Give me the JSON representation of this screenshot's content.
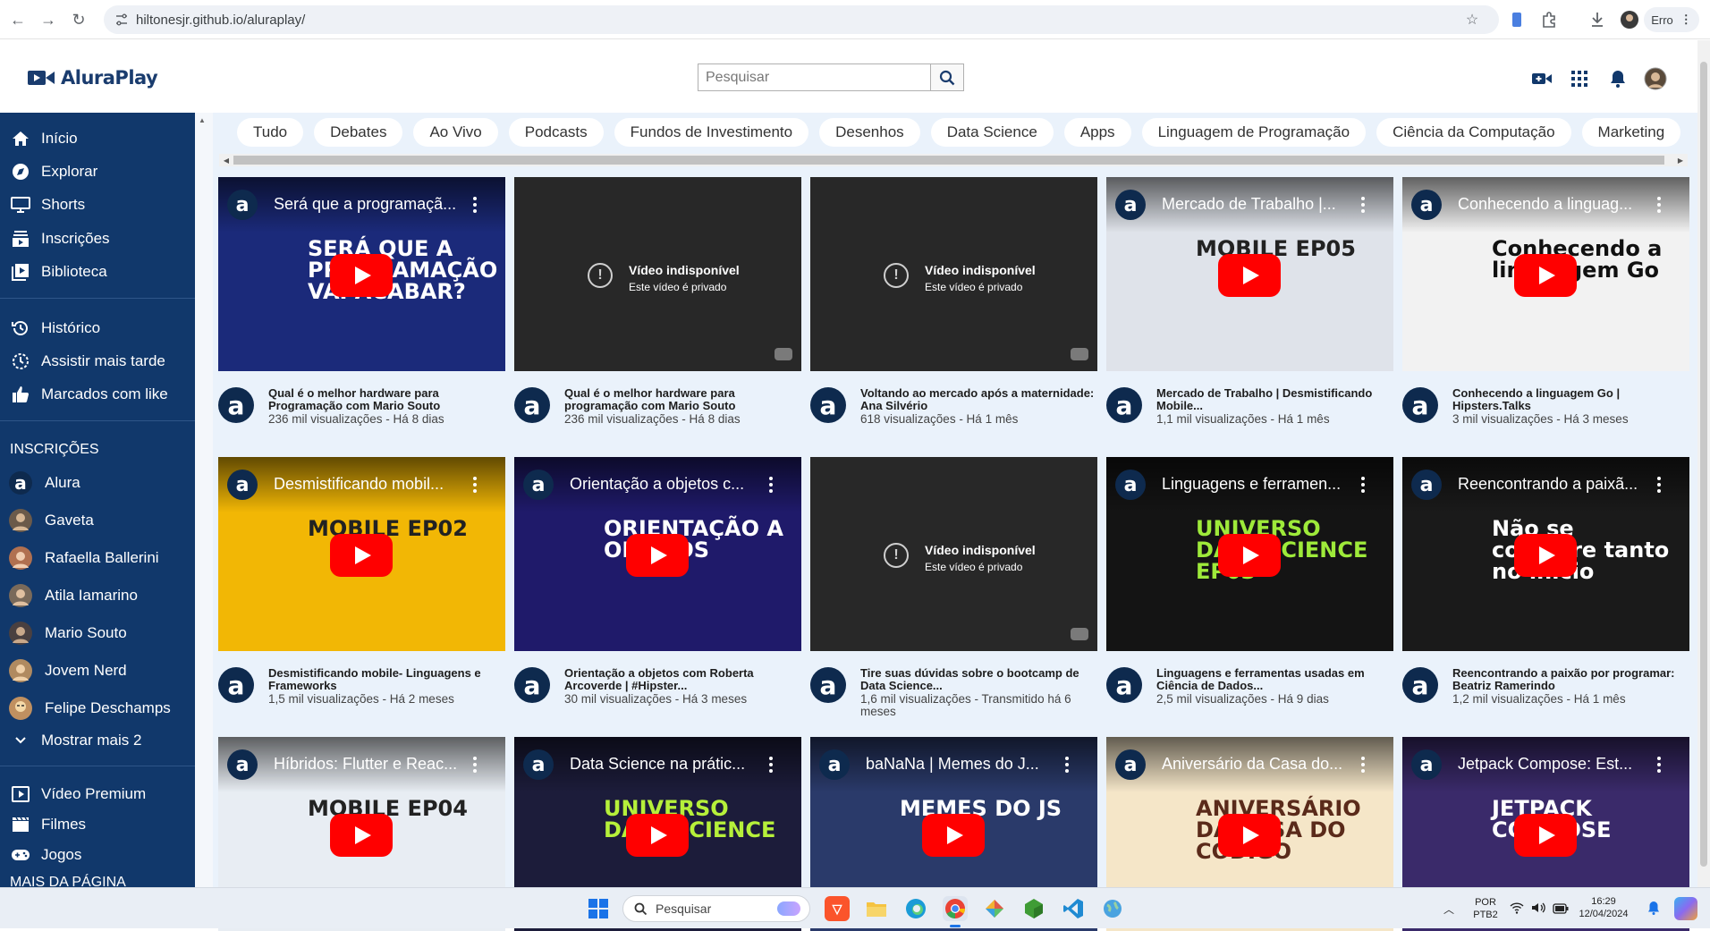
{
  "browser": {
    "url": "hiltonesjr.github.io/aluraplay/",
    "profile_label": "Erro"
  },
  "app": {
    "logo_text": "AluraPlay",
    "search_placeholder": "Pesquisar"
  },
  "sidebar": {
    "main": [
      {
        "label": "Início",
        "icon": "home-icon"
      },
      {
        "label": "Explorar",
        "icon": "compass-icon"
      },
      {
        "label": "Shorts",
        "icon": "screen-icon"
      },
      {
        "label": "Inscrições",
        "icon": "subscriptions-icon"
      },
      {
        "label": "Biblioteca",
        "icon": "library-icon"
      }
    ],
    "library": [
      {
        "label": "Histórico",
        "icon": "history-icon"
      },
      {
        "label": "Assistir mais tarde",
        "icon": "clock-icon"
      },
      {
        "label": "Marcados com like",
        "icon": "thumbs-up-icon"
      }
    ],
    "subscriptions_heading": "INSCRIÇÕES",
    "subscriptions": [
      {
        "label": "Alura",
        "color": "#0e2a4e"
      },
      {
        "label": "Gaveta",
        "color": "#6b5a4a"
      },
      {
        "label": "Rafaella Ballerini",
        "color": "#b07050"
      },
      {
        "label": "Atila Iamarino",
        "color": "#7a6a5a"
      },
      {
        "label": "Mario Souto",
        "color": "#4a4040"
      },
      {
        "label": "Jovem Nerd",
        "color": "#b08a60"
      },
      {
        "label": "Felipe Deschamps",
        "color": "#c09060"
      }
    ],
    "show_more": "Mostrar mais 2",
    "extras": [
      {
        "label": "Vídeo Premium",
        "icon": "video-icon"
      },
      {
        "label": "Filmes",
        "icon": "film-icon"
      },
      {
        "label": "Jogos",
        "icon": "gamepad-icon"
      }
    ],
    "more_heading": "MAIS DA PÁGINA"
  },
  "chips": [
    "Tudo",
    "Debates",
    "Ao Vivo",
    "Podcasts",
    "Fundos de Investimento",
    "Desenhos",
    "Data Science",
    "Apps",
    "Linguagem de Programação",
    "Ciência da Computação",
    "Marketing"
  ],
  "unavailable": {
    "title": "Vídeo indisponível",
    "subtitle": "Este vídeo é privado"
  },
  "videos": [
    {
      "thumb_title": "Será que a programaçã...",
      "title": "Qual é o melhor hardware para Programação com Mario Souto",
      "stats": "236 mil visualizações - Há 8 dias",
      "bg": "#1b2a7a",
      "art": "SERÁ QUE A PROGRAMAÇÃO VAI ACABAR?",
      "unavailable": false
    },
    {
      "thumb_title": "",
      "title": "Qual é o melhor hardware para programação com Mario Souto",
      "stats": "236 mil visualizações - Há 8 dias",
      "bg": "#282828",
      "art": "",
      "unavailable": true
    },
    {
      "thumb_title": "",
      "title": "Voltando ao mercado após a maternidade: Ana Silvério",
      "stats": "618 visualizações - Há 1 mês",
      "bg": "#282828",
      "art": "",
      "unavailable": true
    },
    {
      "thumb_title": "Mercado de Trabalho |...",
      "title": "Mercado de Trabalho | Desmistificando Mobile...",
      "stats": "1,1 mil visualizações - Há 1 mês",
      "bg": "#dfe3ea",
      "art": "MOBILE EP05",
      "unavailable": false
    },
    {
      "thumb_title": "Conhecendo a linguag...",
      "title": "Conhecendo a linguagem Go | Hipsters.Talks",
      "stats": "3 mil visualizações - Há 3 meses",
      "bg": "#f2f2f2",
      "art": "Conhecendo a linguagem Go",
      "unavailable": false
    },
    {
      "thumb_title": "Desmistificando mobil...",
      "title": "Desmistificando mobile- Linguagens e Frameworks",
      "stats": "1,5 mil visualizações - Há 2 meses",
      "bg": "#f2b705",
      "art": "MOBILE EP02",
      "unavailable": false
    },
    {
      "thumb_title": "Orientação a objetos c...",
      "title": "Orientação a objetos com Roberta Arcoverde | #Hipster...",
      "stats": "30 mil visualizações - Há 3 meses",
      "bg": "#1f1a6a",
      "art": "ORIENTAÇÃO A OBJETOS",
      "unavailable": false
    },
    {
      "thumb_title": "",
      "title": "Tire suas dúvidas sobre o bootcamp de Data Science...",
      "stats": "1,6 mil visualizações - Transmitido há 6 meses",
      "bg": "#282828",
      "art": "",
      "unavailable": true
    },
    {
      "thumb_title": "Linguagens e ferramen...",
      "title": "Linguagens e ferramentas usadas em Ciência de Dados...",
      "stats": "2,5 mil visualizações - Há 9 dias",
      "bg": "#141414",
      "art": "UNIVERSO DATA SCIENCE EP03",
      "unavailable": false
    },
    {
      "thumb_title": "Reencontrando a paixã...",
      "title": "Reencontrando a paixão por programar: Beatriz Ramerindo",
      "stats": "1,2 mil visualizações - Há 1 mês",
      "bg": "#1a1a1a",
      "art": "Não se compare tanto no início",
      "unavailable": false
    },
    {
      "thumb_title": "Híbridos: Flutter e Reac...",
      "title": "",
      "stats": "",
      "bg": "#e8edf3",
      "art": "MOBILE EP04",
      "unavailable": false
    },
    {
      "thumb_title": "Data Science na prátic...",
      "title": "",
      "stats": "",
      "bg": "#1c1c3a",
      "art": "UNIVERSO DATA SCIENCE",
      "unavailable": false
    },
    {
      "thumb_title": "baNaNa | Memes do J...",
      "title": "",
      "stats": "",
      "bg": "#2a3a6a",
      "art": "MEMES DO JS",
      "unavailable": false
    },
    {
      "thumb_title": "Aniversário da Casa do...",
      "title": "",
      "stats": "",
      "bg": "#f5e6c8",
      "art": "ANIVERSÁRIO DA CASA DO CÓDIGO",
      "unavailable": false
    },
    {
      "thumb_title": "Jetpack Compose: Est...",
      "title": "",
      "stats": "",
      "bg": "#3a2a6a",
      "art": "JETPACK COMPOSE",
      "unavailable": false
    }
  ],
  "taskbar": {
    "search_placeholder": "Pesquisar",
    "lang_top": "POR",
    "lang_bottom": "PTB2",
    "time": "16:29",
    "date": "12/04/2024"
  }
}
